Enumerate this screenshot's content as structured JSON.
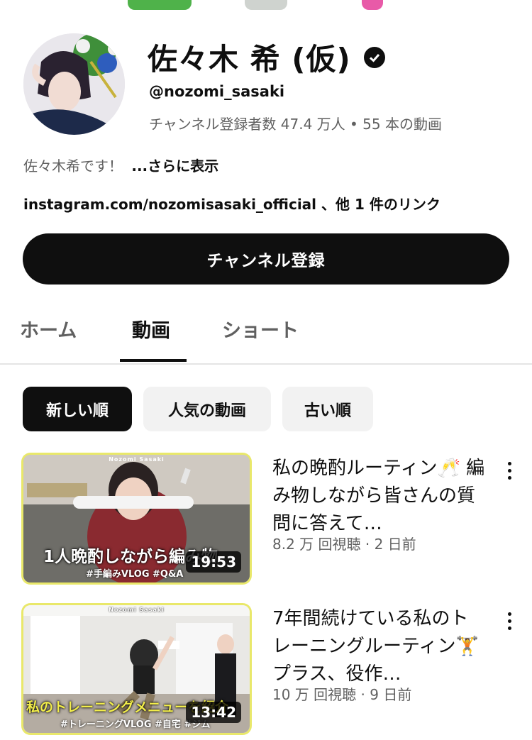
{
  "channel": {
    "name": "佐々木 希 (仮)",
    "handle": "@nozomi_sasaki",
    "stats": "チャンネル登録者数 47.4 万人 • 55 本の動画",
    "description": "佐々木希です！",
    "description_more": "...さらに表示",
    "links": "instagram.com/nozomisasaki_official 、他 1 件のリンク",
    "verified_icon": "verified-check-icon"
  },
  "subscribe": {
    "label": "チャンネル登録"
  },
  "tabs": [
    {
      "label": "ホーム",
      "active": false
    },
    {
      "label": "動画",
      "active": true
    },
    {
      "label": "ショート",
      "active": false
    }
  ],
  "chips": [
    {
      "label": "新しい順",
      "selected": true
    },
    {
      "label": "人気の動画",
      "selected": false
    },
    {
      "label": "古い順",
      "selected": false
    }
  ],
  "videos": [
    {
      "title": "私の晩酌ルーティン🥂 編み物しながら皆さんの質問に答えて…",
      "meta": "8.2 万 回視聴 · 2 日前",
      "duration": "19:53",
      "thumb_caption": "1人晩酌しながら編み物",
      "thumb_tags": "#手編みVLOG  #Q&A",
      "thumb_brand": "Nozomi Sasaki"
    },
    {
      "title": "7年間続けている私のトレーニングルーティン🏋️ プラス、役作…",
      "meta": "10 万 回視聴 · 9 日前",
      "duration": "13:42",
      "thumb_caption": "私のトレーニングメニューを紹介",
      "thumb_tags": "#トレーニングVLOG  #自宅  #ジム",
      "thumb_brand": "Nozomi Sasaki"
    }
  ],
  "colors": {
    "text_primary": "#0f0f0f",
    "text_secondary": "#606060",
    "chip_bg": "#f2f2f2",
    "thumb_border": "#e9e86a"
  }
}
